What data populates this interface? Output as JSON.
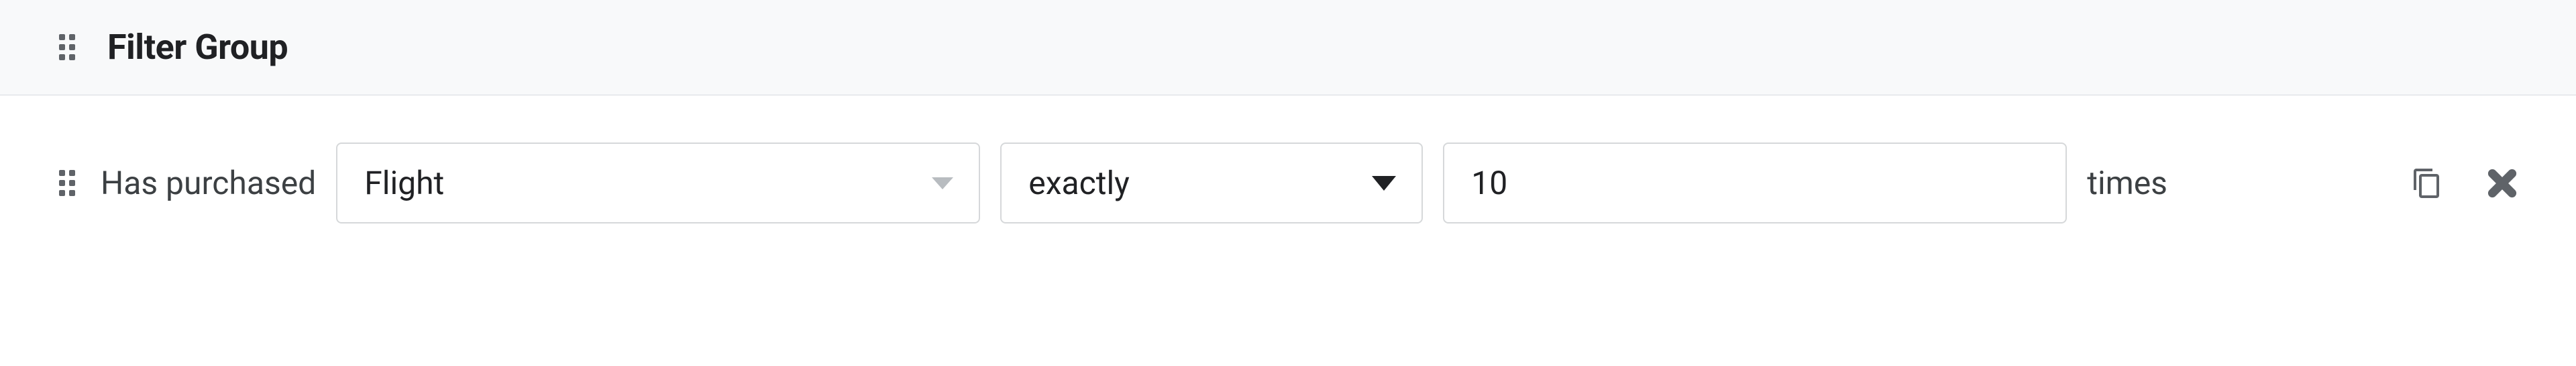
{
  "header": {
    "title": "Filter Group"
  },
  "filter": {
    "prefix_label": "Has purchased",
    "product_select": {
      "value": "Flight",
      "options": [
        "Flight"
      ]
    },
    "operator_select": {
      "value": "exactly",
      "options": [
        "exactly"
      ]
    },
    "count_input": {
      "value": "10"
    },
    "suffix_label": "times"
  }
}
